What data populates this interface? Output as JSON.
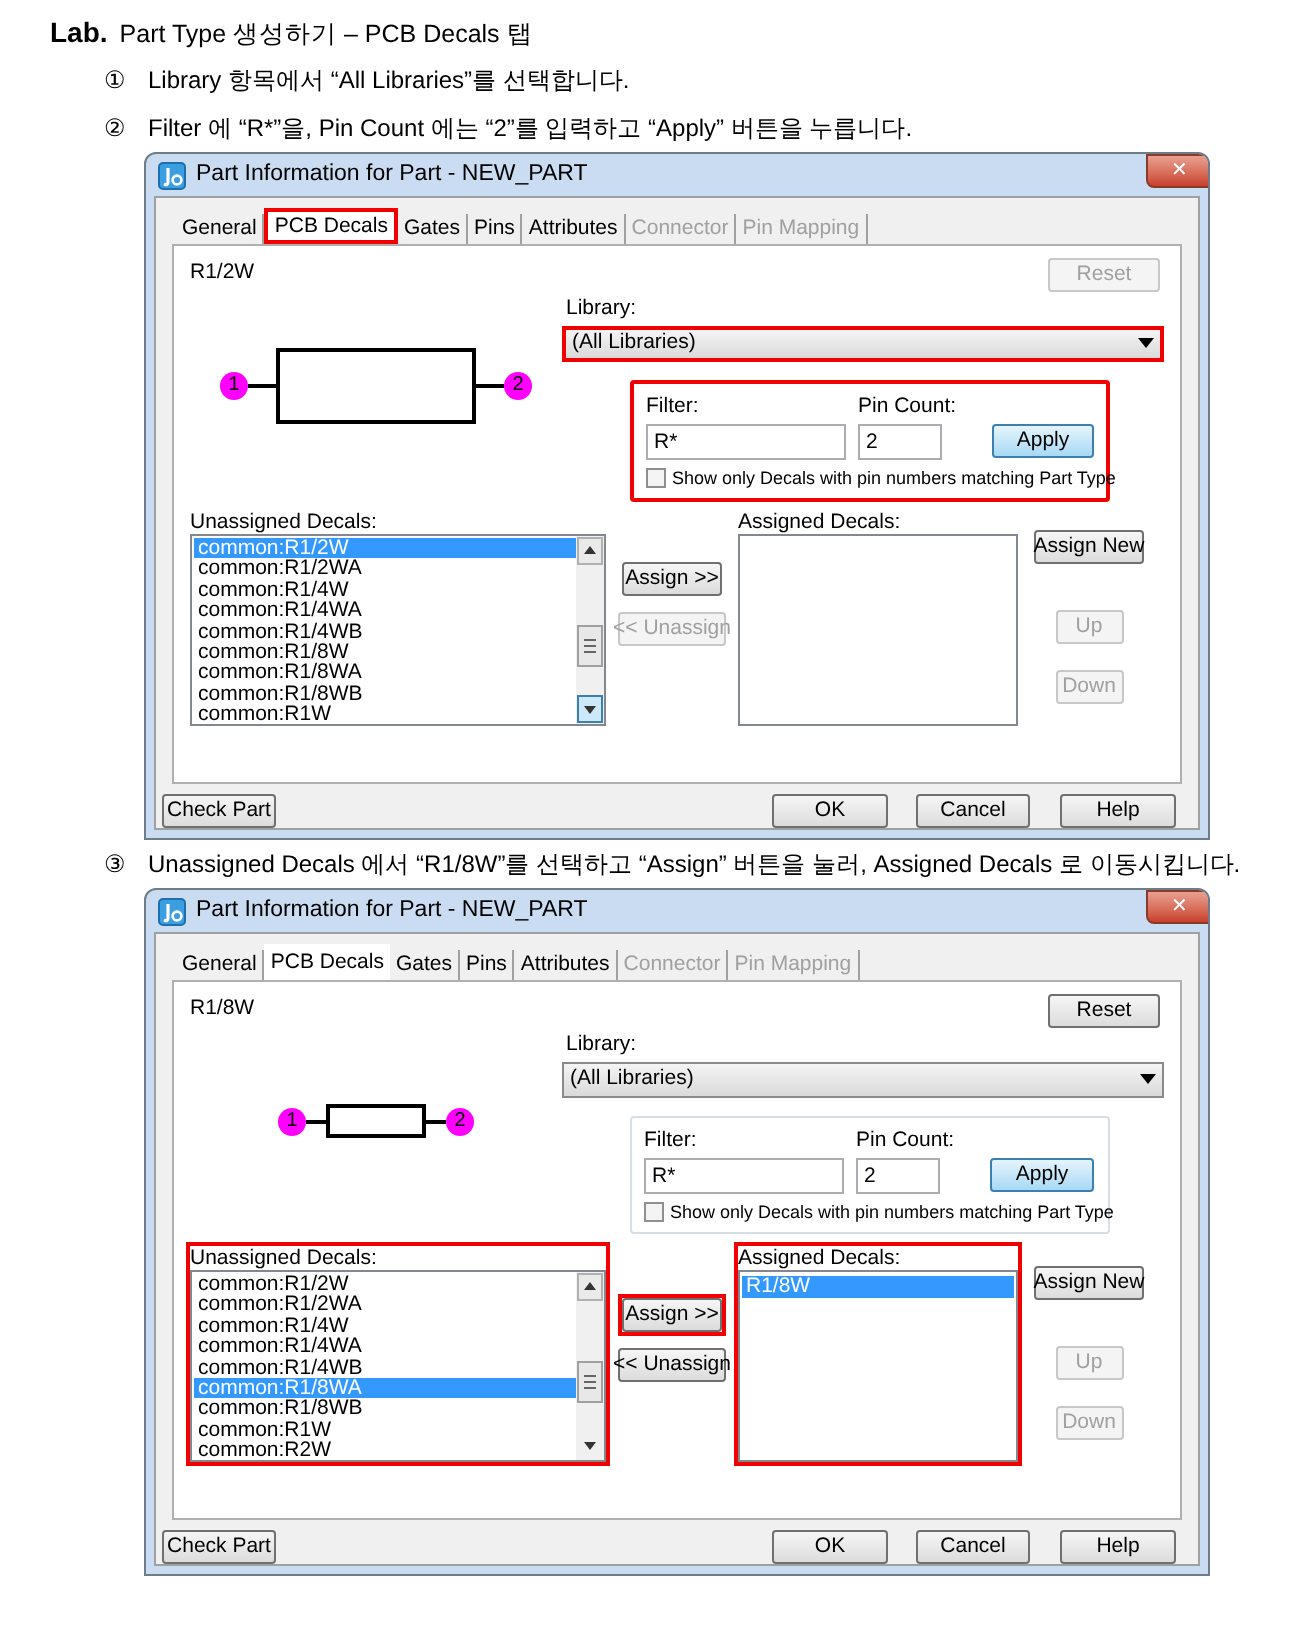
{
  "heading": {
    "label": "Lab.",
    "text": "Part Type 생성하기 – PCB Decals 탭"
  },
  "content": [
    {
      "kind": "step",
      "marker": "①",
      "text": "Library 항목에서 “All Libraries”를 선택합니다."
    },
    {
      "kind": "step",
      "marker": "②",
      "text": "Filter 에 “R*”을, Pin Count 에는 “2”를 입력하고 “Apply” 버튼을 누릅니다."
    },
    {
      "kind": "dialog",
      "title": "Part Information for Part - NEW_PART",
      "close": "✕",
      "tabs": [
        {
          "label": "General",
          "selected": false,
          "disabled": false,
          "highlighted": false
        },
        {
          "label": "PCB Decals",
          "selected": true,
          "disabled": false,
          "highlighted": true
        },
        {
          "label": "Gates",
          "selected": false,
          "disabled": false,
          "highlighted": false
        },
        {
          "label": "Pins",
          "selected": false,
          "disabled": false,
          "highlighted": false
        },
        {
          "label": "Attributes",
          "selected": false,
          "disabled": false,
          "highlighted": false
        },
        {
          "label": "Connector",
          "selected": false,
          "disabled": true,
          "highlighted": false
        },
        {
          "label": "Pin Mapping",
          "selected": false,
          "disabled": true,
          "highlighted": false
        }
      ],
      "part_name": "R1/2W",
      "compact_preview": false,
      "pins": [
        "1",
        "2"
      ],
      "reset": {
        "label": "Reset",
        "disabled": true
      },
      "library": {
        "label": "Library:",
        "value": "(All Libraries)",
        "highlighted": true
      },
      "filter_group": {
        "highlighted": true,
        "filter": {
          "label": "Filter:",
          "value": "R*"
        },
        "pin_count": {
          "label": "Pin Count:",
          "value": "2"
        },
        "apply": "Apply",
        "show_only": {
          "label": "Show only Decals with pin numbers matching Part Type",
          "checked": false
        }
      },
      "unassigned": {
        "label": "Unassigned Decals:",
        "highlighted": false,
        "items": [
          {
            "text": "common:R1/2W",
            "selected": true
          },
          {
            "text": "common:R1/2WA",
            "selected": false
          },
          {
            "text": "common:R1/4W",
            "selected": false
          },
          {
            "text": "common:R1/4WA",
            "selected": false
          },
          {
            "text": "common:R1/4WB",
            "selected": false
          },
          {
            "text": "common:R1/8W",
            "selected": false
          },
          {
            "text": "common:R1/8WA",
            "selected": false
          },
          {
            "text": "common:R1/8WB",
            "selected": false
          },
          {
            "text": "common:R1W",
            "selected": false
          }
        ]
      },
      "assign": {
        "label": "Assign >>",
        "highlighted": false
      },
      "unassign": {
        "label": "<< Unassign",
        "disabled": true
      },
      "assigned": {
        "label": "Assigned Decals:",
        "highlighted": false
      },
      "assign_new": "Assign New",
      "up": {
        "label": "Up",
        "disabled": true
      },
      "down": {
        "label": "Down",
        "disabled": true
      },
      "buttons": {
        "check_part": "Check Part",
        "ok": "OK",
        "cancel": "Cancel",
        "help": "Help"
      }
    },
    {
      "kind": "step",
      "marker": "③",
      "text": "Unassigned Decals 에서 “R1/8W”를 선택하고 “Assign” 버튼을 눌러, Assigned Decals 로 이동시킵니다."
    },
    {
      "kind": "dialog",
      "title": "Part Information for Part - NEW_PART",
      "close": "✕",
      "tabs": [
        {
          "label": "General",
          "selected": false,
          "disabled": false,
          "highlighted": false
        },
        {
          "label": "PCB Decals",
          "selected": true,
          "disabled": false,
          "highlighted": false
        },
        {
          "label": "Gates",
          "selected": false,
          "disabled": false,
          "highlighted": false
        },
        {
          "label": "Pins",
          "selected": false,
          "disabled": false,
          "highlighted": false
        },
        {
          "label": "Attributes",
          "selected": false,
          "disabled": false,
          "highlighted": false
        },
        {
          "label": "Connector",
          "selected": false,
          "disabled": true,
          "highlighted": false
        },
        {
          "label": "Pin Mapping",
          "selected": false,
          "disabled": true,
          "highlighted": false
        }
      ],
      "part_name": "R1/8W",
      "compact_preview": true,
      "pins": [
        "1",
        "2"
      ],
      "reset": {
        "label": "Reset",
        "disabled": false
      },
      "library": {
        "label": "Library:",
        "value": "(All Libraries)",
        "highlighted": false
      },
      "filter_group": {
        "highlighted": false,
        "filter": {
          "label": "Filter:",
          "value": "R*"
        },
        "pin_count": {
          "label": "Pin Count:",
          "value": "2"
        },
        "apply": "Apply",
        "show_only": {
          "label": "Show only Decals with pin numbers matching Part Type",
          "checked": false
        }
      },
      "unassigned": {
        "label": "Unassigned Decals:",
        "highlighted": true,
        "items": [
          {
            "text": "common:R1/2W",
            "selected": false
          },
          {
            "text": "common:R1/2WA",
            "selected": false
          },
          {
            "text": "common:R1/4W",
            "selected": false
          },
          {
            "text": "common:R1/4WA",
            "selected": false
          },
          {
            "text": "common:R1/4WB",
            "selected": false
          },
          {
            "text": "common:R1/8WA",
            "selected": true
          },
          {
            "text": "common:R1/8WB",
            "selected": false
          },
          {
            "text": "common:R1W",
            "selected": false
          },
          {
            "text": "common:R2W",
            "selected": false
          }
        ]
      },
      "assign": {
        "label": "Assign >>",
        "highlighted": true
      },
      "unassign": {
        "label": "<< Unassign",
        "disabled": false
      },
      "assigned": {
        "label": "Assigned Decals:",
        "highlighted": true,
        "items": [
          {
            "text": "R1/8W",
            "selected": true
          }
        ]
      },
      "assign_new": "Assign New",
      "up": {
        "label": "Up",
        "disabled": true
      },
      "down": {
        "label": "Down",
        "disabled": true
      },
      "buttons": {
        "check_part": "Check Part",
        "ok": "OK",
        "cancel": "Cancel",
        "help": "Help"
      }
    }
  ]
}
